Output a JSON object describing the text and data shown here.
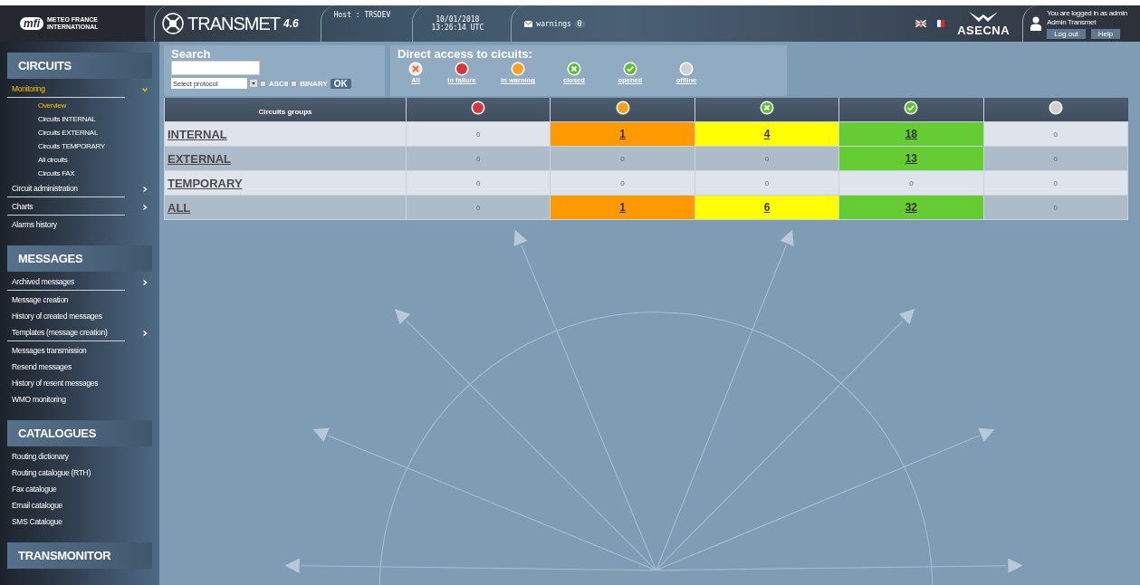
{
  "header": {
    "logo": {
      "mark": "mfi",
      "line_1": "METEO FRANCE",
      "line_2": "INTERNATIONAL"
    },
    "app": {
      "name": "TRANSMET",
      "version": "4.6"
    },
    "host": "Host : TRSDEV",
    "date": "10/01/2018",
    "time": "13:26:14 UTC",
    "warnings": {
      "label": "warnings",
      "count": "0"
    },
    "brand": "ASECNA",
    "user": {
      "status": "You are logged in as admin",
      "name": "Admin Transmet",
      "buttons": [
        "Log out",
        "Help"
      ]
    }
  },
  "sidebar": {
    "sections": [
      {
        "title": "CIRCUITS",
        "items": [
          {
            "label": "Monitoring",
            "selected": true,
            "submenu": true,
            "expanded": true,
            "children": [
              {
                "label": "Overview",
                "selected": true
              },
              {
                "label": "Circuits INTERNAL",
                "selected": false
              },
              {
                "label": "Circuits EXTERNAL",
                "selected": false
              },
              {
                "label": "Circuits TEMPORARY",
                "selected": false
              },
              {
                "label": "All circuits",
                "selected": false
              },
              {
                "label": "Circuits FAX",
                "selected": false
              }
            ]
          },
          {
            "label": "Circuit administration",
            "selected": false,
            "submenu": true,
            "expanded": false
          },
          {
            "label": "Charts",
            "selected": false,
            "submenu": true,
            "expanded": false
          },
          {
            "label": "Alarms history",
            "selected": false,
            "submenu": false
          }
        ]
      },
      {
        "title": "MESSAGES",
        "items": [
          {
            "label": "Archived messages",
            "selected": false,
            "submenu": true,
            "expanded": false
          },
          {
            "label": "Message creation",
            "selected": false,
            "submenu": false
          },
          {
            "label": "History of created messages",
            "selected": false,
            "submenu": false
          },
          {
            "label": "Templates (message creation)",
            "selected": false,
            "submenu": true,
            "expanded": false
          },
          {
            "label": "Messages transmission",
            "selected": false,
            "submenu": false
          },
          {
            "label": "Resend messages",
            "selected": false,
            "submenu": false
          },
          {
            "label": "History of resent messages",
            "selected": false,
            "submenu": false
          },
          {
            "label": "WMO monitoring",
            "selected": false,
            "submenu": false
          }
        ]
      },
      {
        "title": "CATALOGUES",
        "items": [
          {
            "label": "Routing dictionary",
            "selected": false,
            "submenu": false
          },
          {
            "label": "Routing catalogue (RTH)",
            "selected": false,
            "submenu": false
          },
          {
            "label": "Fax catalogue",
            "selected": false,
            "submenu": false
          },
          {
            "label": "Email catalogue",
            "selected": false,
            "submenu": false
          },
          {
            "label": "SMS Catalogue",
            "selected": false,
            "submenu": false
          }
        ]
      },
      {
        "title": "TRANSMONITOR"
      }
    ]
  },
  "search": {
    "title": "Search",
    "protocol": "Select protocol",
    "options": [
      {
        "label": "ASCII",
        "checked": false
      },
      {
        "label": "BINARY",
        "checked": false
      }
    ],
    "button": "OK"
  },
  "direct_access": {
    "title": "Direct access to cicuits:",
    "items": [
      {
        "kind": "all",
        "label": "All"
      },
      {
        "kind": "failure",
        "label": "in failure"
      },
      {
        "kind": "warning",
        "label": "in warning"
      },
      {
        "kind": "closed",
        "label": "closed"
      },
      {
        "kind": "opened",
        "label": "opened"
      },
      {
        "kind": "offline",
        "label": "offline"
      }
    ]
  },
  "table": {
    "columns": [
      {
        "kind": "name",
        "label": "Circuits groups"
      },
      {
        "kind": "failure"
      },
      {
        "kind": "warning"
      },
      {
        "kind": "closed"
      },
      {
        "kind": "opened"
      },
      {
        "kind": "offline"
      }
    ],
    "rows": [
      {
        "name": "INTERNAL",
        "cells": [
          {
            "text": "0"
          },
          {
            "text": "1",
            "color": "#ff9900"
          },
          {
            "text": "4",
            "color": "#ffff00"
          },
          {
            "text": "18",
            "color": "#66cc33"
          },
          {
            "text": "0"
          }
        ]
      },
      {
        "name": "EXTERNAL",
        "cells": [
          {
            "text": "0"
          },
          {
            "text": "0"
          },
          {
            "text": "0"
          },
          {
            "text": "13",
            "color": "#66cc33"
          },
          {
            "text": "0"
          }
        ]
      },
      {
        "name": "TEMPORARY",
        "cells": [
          {
            "text": "0"
          },
          {
            "text": "0"
          },
          {
            "text": "0"
          },
          {
            "text": "0"
          },
          {
            "text": "0"
          }
        ]
      },
      {
        "name": "ALL",
        "cells": [
          {
            "text": "0"
          },
          {
            "text": "1",
            "color": "#ff9900"
          },
          {
            "text": "6",
            "color": "#ffff00"
          },
          {
            "text": "32",
            "color": "#66cc33"
          },
          {
            "text": "0"
          }
        ]
      }
    ]
  }
}
